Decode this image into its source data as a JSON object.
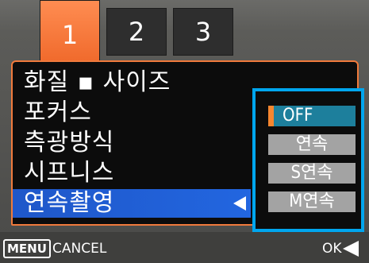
{
  "tabs": [
    {
      "label": "1",
      "active": true
    },
    {
      "label": "2",
      "active": false
    },
    {
      "label": "3",
      "active": false
    }
  ],
  "menu": {
    "items": [
      {
        "label": "화질 ▪ 사이즈"
      },
      {
        "label": "포커스"
      },
      {
        "label": "측광방식"
      },
      {
        "label": "시프니스"
      },
      {
        "label": "연속촬영",
        "selected": true
      }
    ]
  },
  "options": {
    "items": [
      {
        "label": "OFF",
        "selected": true
      },
      {
        "label": "연속"
      },
      {
        "label": "S연속"
      },
      {
        "label": "M연속"
      }
    ]
  },
  "footer": {
    "menu_key": "MENU",
    "cancel_label": "CANCEL",
    "ok_label": "OK"
  },
  "colors": {
    "active_tab": "#f06a2c",
    "selection_blue": "#2266e0",
    "options_frame": "#00a6ee",
    "option_selected": "#1d7f9c"
  },
  "icons": {
    "item_selected_arrow": "left-arrow-icon",
    "ok_arrow": "left-arrow-icon"
  }
}
